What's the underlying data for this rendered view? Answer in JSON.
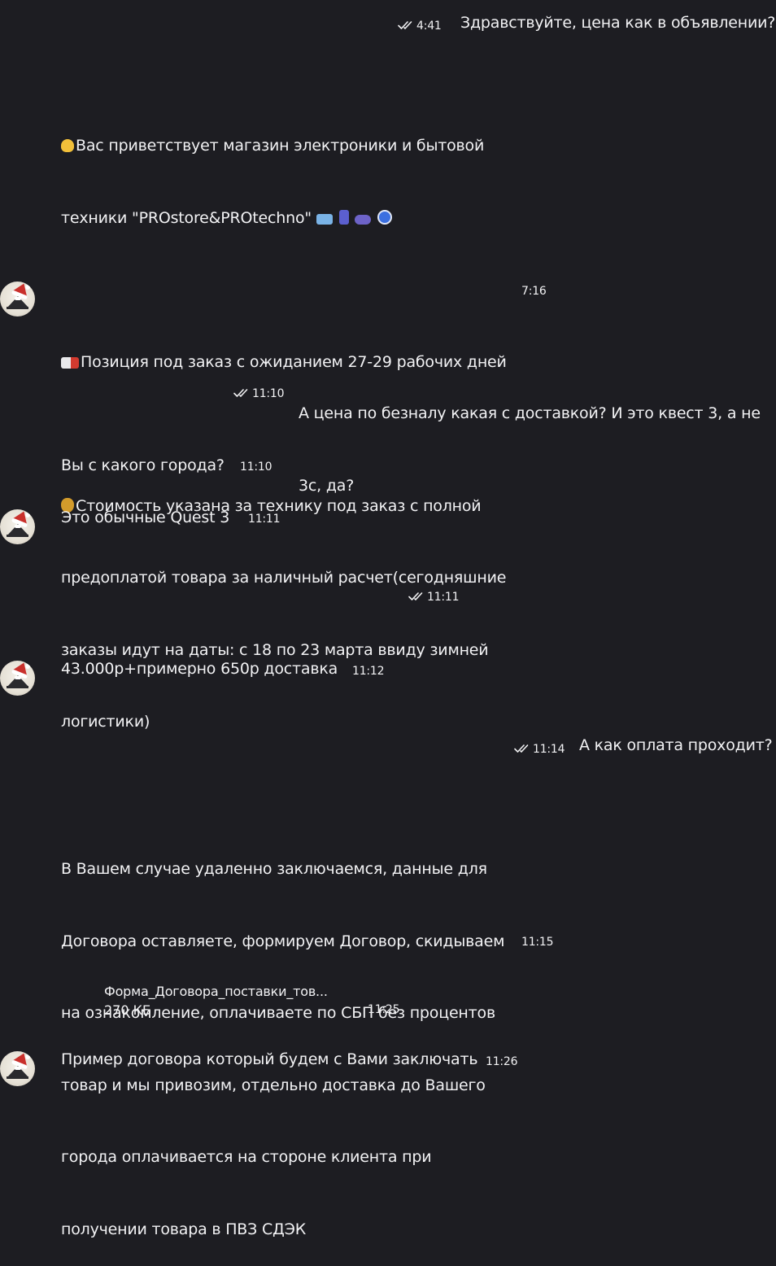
{
  "messages": {
    "m1": {
      "text": "Здравствуйте, цена как в объявлении?",
      "time": "4:41"
    },
    "m2": {
      "line1": "Вас приветствует магазин электроники и бытовой",
      "line2": "техники \"PROstore&PROtechno\"",
      "line3": "Позиция под заказ с ожиданием 27-29 рабочих дней",
      "line4": "Стоимость указана за технику под заказ с полной",
      "line5": "предоплатой товара за наличный расчет(сегодняшние",
      "line6": "заказы идут на даты: с 18 по 23 марта ввиду зимней",
      "line7": "логистики)",
      "time": "7:16"
    },
    "m3": {
      "line1": "А цена по безналу какая с доставкой? И это квест 3, а не",
      "line2": "3с, да?",
      "time": "11:10"
    },
    "m4": {
      "text": "Вы с какого города?",
      "time": "11:10"
    },
    "m5": {
      "text": "Это обычные Quest 3",
      "time": "11:11"
    },
    "m6": {
      "time": "11:11"
    },
    "m7": {
      "text": "43.000р+примерно 650р доставка",
      "time": "11:12"
    },
    "m8": {
      "text": "А как оплата проходит?",
      "time": "11:14"
    },
    "m9": {
      "line1": "В Вашем случае удаленно заключаемся, данные для",
      "line2": "Договора оставляете, формируем Договор, скидываем",
      "line3": "на ознакомление, оплачиваете по СБП без процентов",
      "line4": "товар и мы привозим, отдельно доставка до Вашего",
      "line5": "города оплачивается на стороне клиента при",
      "line6": "получении товара в ПВЗ СДЭК",
      "time": "11:15"
    },
    "m10": {
      "file_name": "Форма_Договора_поставки_тов...",
      "file_size": "270 КБ",
      "time": "11:25"
    },
    "m11": {
      "text": "Пример договора который будем с Вами заключать",
      "time": "11:26"
    }
  },
  "icons": [
    "double-check-icon",
    "waving-hand-icon",
    "laptop-icon",
    "phone-icon",
    "gamepad-icon",
    "clock-icon",
    "truck-icon",
    "money-bag-icon",
    "avatar"
  ],
  "colors": {
    "background": "#1d1d22",
    "text": "#f2f2f4"
  }
}
